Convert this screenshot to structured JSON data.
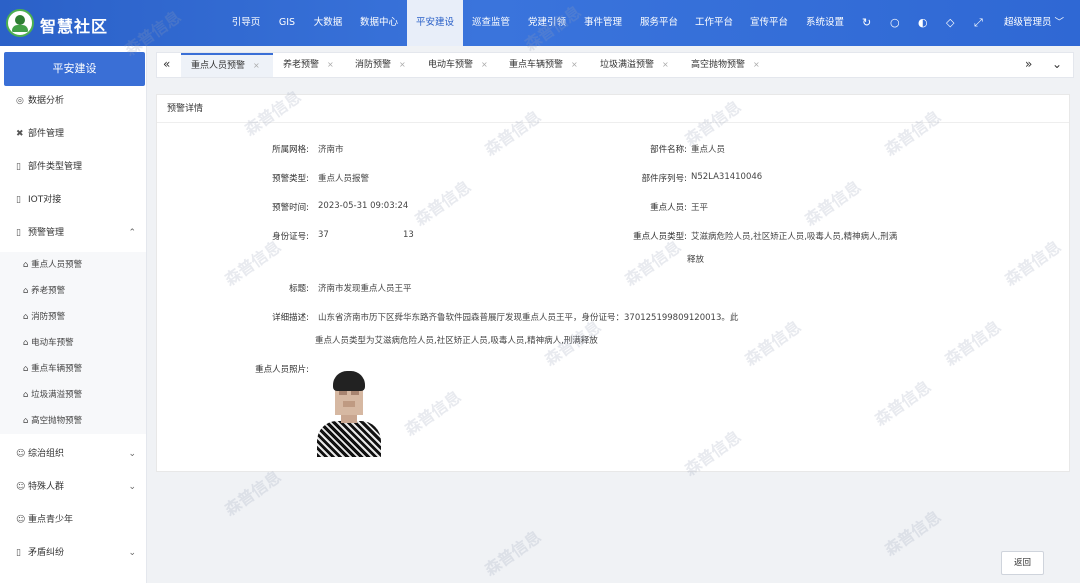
{
  "header": {
    "title": "智慧社区",
    "nav": [
      "引导页",
      "GIS",
      "大数据",
      "数据中心",
      "平安建设",
      "巡查监管",
      "党建引领",
      "事件管理",
      "服务平台",
      "工作平台",
      "宣传平台",
      "系统设置"
    ],
    "active_nav": "平安建设",
    "user": "超级管理员 ﹀"
  },
  "sidebar": {
    "title": "平安建设",
    "items": [
      {
        "label": "数据分析",
        "icon": "chart-icon"
      },
      {
        "label": "部件管理",
        "icon": "component-icon"
      },
      {
        "label": "部件类型管理",
        "icon": "document-icon"
      },
      {
        "label": "IOT对接",
        "icon": "document-icon"
      },
      {
        "label": "预警管理",
        "icon": "document-icon",
        "expanded": true
      }
    ],
    "sub_items": [
      "重点人员预警",
      "养老预警",
      "消防预警",
      "电动车预警",
      "重点车辆预警",
      "垃圾满溢预警",
      "高空抛物预警"
    ],
    "bottom_items": [
      {
        "label": "综治组织",
        "icon": "user-icon"
      },
      {
        "label": "特殊人群",
        "icon": "user-icon"
      },
      {
        "label": "重点青少年",
        "icon": "user-icon"
      },
      {
        "label": "矛盾纠纷",
        "icon": "document-icon"
      }
    ]
  },
  "tabs": [
    "重点人员预警",
    "养老预警",
    "消防预警",
    "电动车预警",
    "重点车辆预警",
    "垃圾满溢预警",
    "高空抛物预警"
  ],
  "active_tab": "重点人员预警",
  "detail": {
    "panel_title": "预警详情",
    "fields": {
      "grid_label": "所属网格:",
      "grid_value": "济南市",
      "part_name_label": "部件名称:",
      "part_name_value": "重点人员",
      "type_label": "预警类型:",
      "type_value": "重点人员报警",
      "serial_label": "部件序列号:",
      "serial_value": "N52LA31410046",
      "time_label": "预警时间:",
      "time_value": "2023-05-31 09:03:24",
      "person_label": "重点人员:",
      "person_value": "王平",
      "id_label": "身份证号:",
      "id_value_start": "37",
      "id_value_end": "13",
      "person_type_label": "重点人员类型:",
      "person_type_value_1": "艾滋病危险人员,社区矫正人员,吸毒人员,精神病人,刑满",
      "person_type_value_2": "释放",
      "title_label": "标题:",
      "title_value": "济南市发现重点人员王平",
      "desc_label": "详细描述:",
      "desc_value_1": "山东省济南市历下区舜华东路齐鲁软件园森普展厅发现重点人员王平，身份证号：370125199809120013。此",
      "desc_value_2": "重点人员类型为艾滋病危险人员,社区矫正人员,吸毒人员,精神病人,刑满释放",
      "photo_label": "重点人员照片:"
    }
  },
  "back_button": "返回",
  "watermark": "森普信息",
  "colors": {
    "primary": "#2b61c8",
    "sidebar_title": "#3a6fd6"
  }
}
